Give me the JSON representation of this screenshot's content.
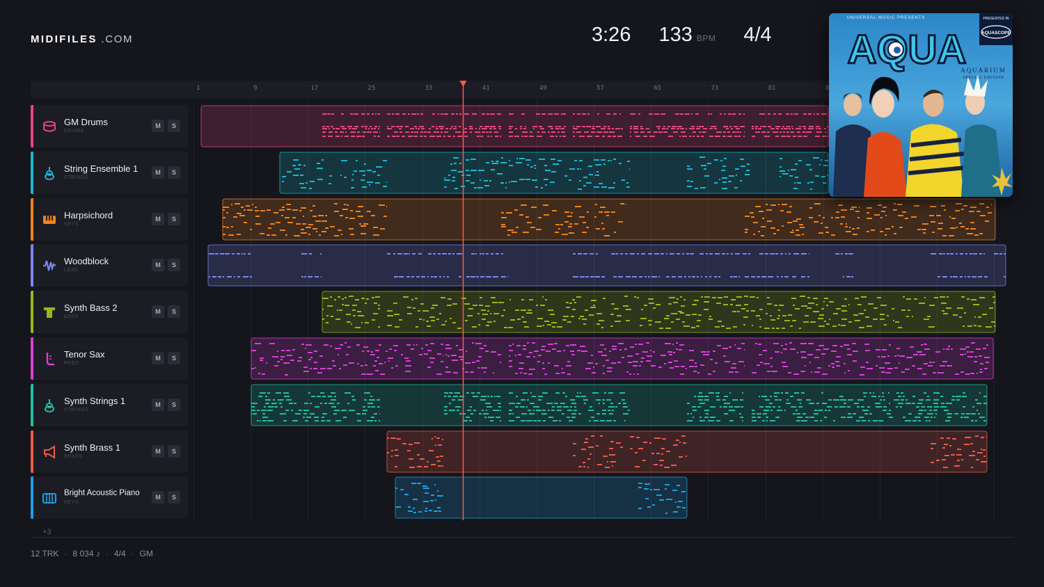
{
  "brand": {
    "name": "MIDIFILES",
    "suffix": " .COM"
  },
  "stats": {
    "duration": "3:26",
    "tempo": "133",
    "tempo_unit": "BPM",
    "time_signature": "4/4"
  },
  "ruler": {
    "ticks": [
      "1",
      "9",
      "17",
      "25",
      "33",
      "41",
      "49",
      "57",
      "65",
      "73",
      "81",
      "8"
    ]
  },
  "playhead": {
    "bar": 38
  },
  "tracks": [
    {
      "name": "GM Drums",
      "category": "DRUMS",
      "color": "#e8457f",
      "icon": "drum-icon",
      "mute": "M",
      "solo": "S"
    },
    {
      "name": "String Ensemble 1",
      "category": "STRINGS",
      "color": "#19b8cf",
      "icon": "violin-icon",
      "mute": "M",
      "solo": "S"
    },
    {
      "name": "Harpsichord",
      "category": "KEYS",
      "color": "#f0821e",
      "icon": "keyboard-icon",
      "mute": "M",
      "solo": "S"
    },
    {
      "name": "Woodblock",
      "category": "LEAD",
      "color": "#7b86f2",
      "icon": "waveform-icon",
      "mute": "M",
      "solo": "S"
    },
    {
      "name": "Synth Bass 2",
      "category": "BASS",
      "color": "#9ab71a",
      "icon": "bass-icon",
      "mute": "M",
      "solo": "S"
    },
    {
      "name": "Tenor Sax",
      "category": "REED",
      "color": "#d93fd9",
      "icon": "saxophone-icon",
      "mute": "M",
      "solo": "S"
    },
    {
      "name": "Synth Strings 1",
      "category": "STRINGS",
      "color": "#1fc0a4",
      "icon": "violin-icon",
      "mute": "M",
      "solo": "S"
    },
    {
      "name": "Synth Brass 1",
      "category": "BRASS",
      "color": "#ee5a4a",
      "icon": "trumpet-icon",
      "mute": "M",
      "solo": "S"
    },
    {
      "name": "Bright Acoustic Piano",
      "category": "KEYS",
      "color": "#1c9fe6",
      "icon": "piano-icon",
      "mute": "M",
      "solo": "S"
    }
  ],
  "more_tracks": "+3",
  "footer": {
    "tracks": "12 TRK",
    "notes": "8 034 ♪",
    "time_signature": "4/4",
    "standard": "GM"
  },
  "album": {
    "title": "AQUA",
    "subtitle": "AQUARIUM",
    "edition": "SPECIAL EDITION",
    "publisher_line": "UNIVERSAL MUSIC PRESENTS",
    "presented": "PRESENTED IN",
    "format": "AQUASCOPE"
  }
}
